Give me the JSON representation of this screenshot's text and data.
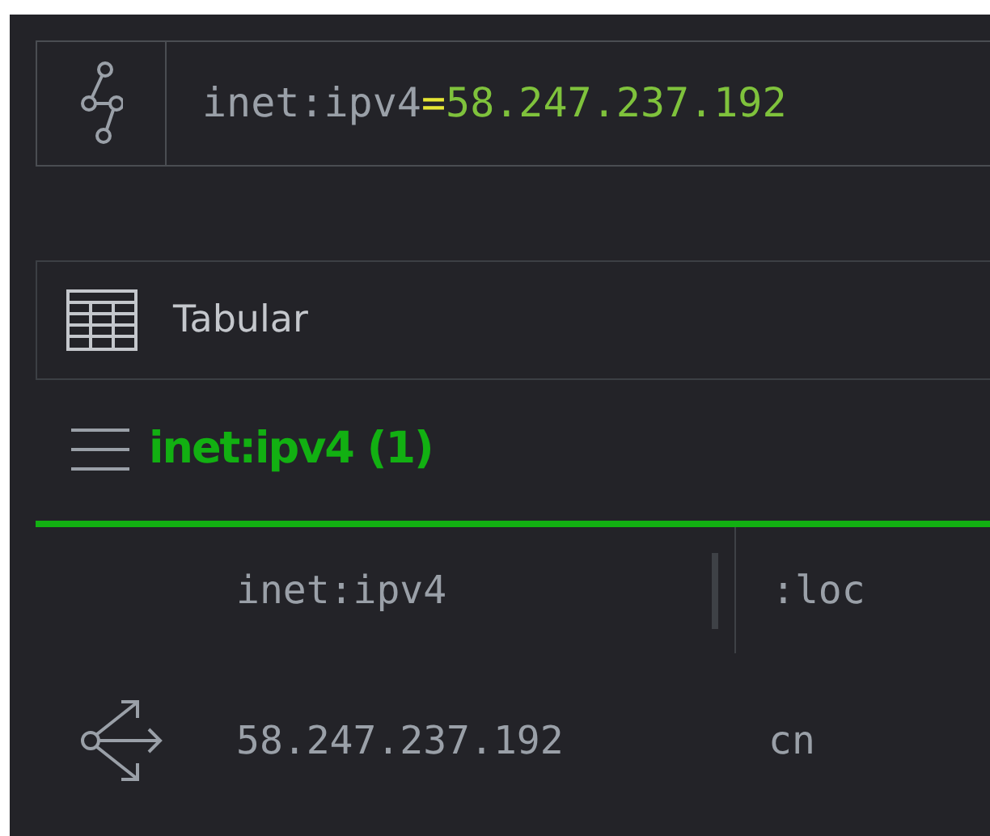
{
  "query": {
    "form": "inet:ipv4",
    "operator": "=",
    "value": "58.247.237.192"
  },
  "view": {
    "label": "Tabular"
  },
  "result_group": {
    "title": "inet:ipv4 (1)"
  },
  "table": {
    "columns": [
      "inet:ipv4",
      ":loc"
    ],
    "rows": [
      {
        "cells": [
          "58.247.237.192",
          "cn"
        ]
      }
    ]
  }
}
